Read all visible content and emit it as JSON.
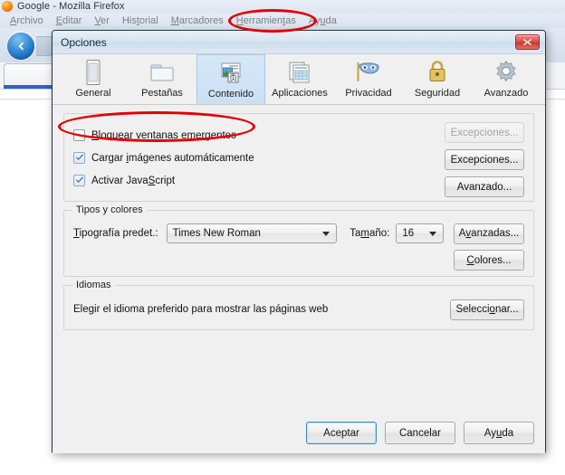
{
  "browser": {
    "title": "Google - Mozilla Firefox",
    "logo_icon": "firefox-logo-icon",
    "back_icon": "back-arrow-icon",
    "menu": [
      {
        "label": "Archivo",
        "accel": "A"
      },
      {
        "label": "Editar",
        "accel": "E"
      },
      {
        "label": "Ver",
        "accel": "V"
      },
      {
        "label": "Historial",
        "accel": "t"
      },
      {
        "label": "Marcadores",
        "accel": "M"
      },
      {
        "label": "Herramientas",
        "accel": "H"
      },
      {
        "label": "Ayuda",
        "accel": "u"
      }
    ]
  },
  "dialog": {
    "title": "Opciones",
    "close_label": "X",
    "tabs": [
      {
        "label": "General",
        "icon": "general-window-icon",
        "selected": false
      },
      {
        "label": "Pestañas",
        "icon": "tabs-folder-icon",
        "selected": false
      },
      {
        "label": "Contenido",
        "icon": "content-page-icon",
        "selected": true
      },
      {
        "label": "Aplicaciones",
        "icon": "applications-grid-icon",
        "selected": false
      },
      {
        "label": "Privacidad",
        "icon": "privacy-mask-icon",
        "selected": false
      },
      {
        "label": "Seguridad",
        "icon": "security-lock-icon",
        "selected": false
      },
      {
        "label": "Avanzado",
        "icon": "advanced-gear-icon",
        "selected": false
      }
    ],
    "content": {
      "checkboxes": [
        {
          "label": "Bloquear ventanas emergentes",
          "checked": false
        },
        {
          "label": "Cargar imágenes automáticamente",
          "checked": true
        },
        {
          "label": "Activar JavaScript",
          "checked": true
        }
      ],
      "side_buttons": [
        {
          "label": "Excepciones...",
          "disabled": true
        },
        {
          "label": "Excepciones...",
          "disabled": false
        },
        {
          "label": "Avanzado...",
          "disabled": false
        }
      ],
      "fonts_group": {
        "legend": "Tipos y colores",
        "font_label": "Tipografía predet.:",
        "font_value": "Times New Roman",
        "size_label": "Tamaño:",
        "size_value": "16",
        "advanced_button": "Avanzadas...",
        "colors_button": "Colores..."
      },
      "languages_group": {
        "legend": "Idiomas",
        "description": "Elegir el idioma preferido para mostrar las páginas web",
        "select_button": "Seleccionar..."
      }
    },
    "footer": {
      "accept": "Aceptar",
      "cancel": "Cancelar",
      "help": "Ayuda"
    }
  },
  "annotations": {
    "color": "#e00000",
    "highlight_menu": "Herramientas",
    "highlight_checkbox": "Bloquear ventanas emergentes"
  }
}
